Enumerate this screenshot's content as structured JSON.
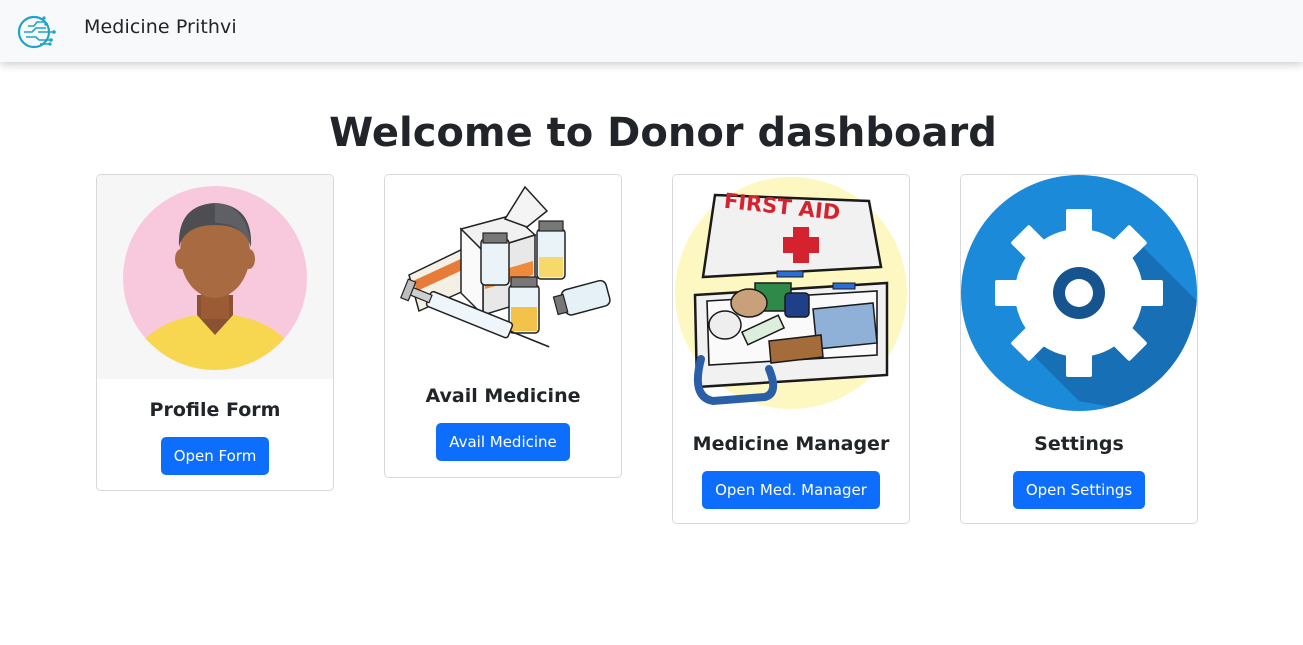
{
  "navbar": {
    "brand_name": "Medicine Prithvi",
    "logo_icon": "circuit-hand-logo-icon"
  },
  "page": {
    "title": "Welcome to Donor dashboard"
  },
  "cards": [
    {
      "title": "Profile Form",
      "button": "Open Form",
      "image_icon": "person-avatar-icon"
    },
    {
      "title": "Avail Medicine",
      "button": "Avail Medicine",
      "image_icon": "medicine-bottles-syringe-icon"
    },
    {
      "title": "Medicine Manager",
      "button": "Open Med. Manager",
      "image_icon": "first-aid-kit-icon",
      "image_text": "FIRST AID"
    },
    {
      "title": "Settings",
      "button": "Open Settings",
      "image_icon": "gear-icon"
    }
  ],
  "colors": {
    "primary": "#0d6efd",
    "navbar_bg": "#f8f9fa",
    "avatar_bg": "#f8c8dc",
    "gear_bg": "#1b8ad9"
  }
}
